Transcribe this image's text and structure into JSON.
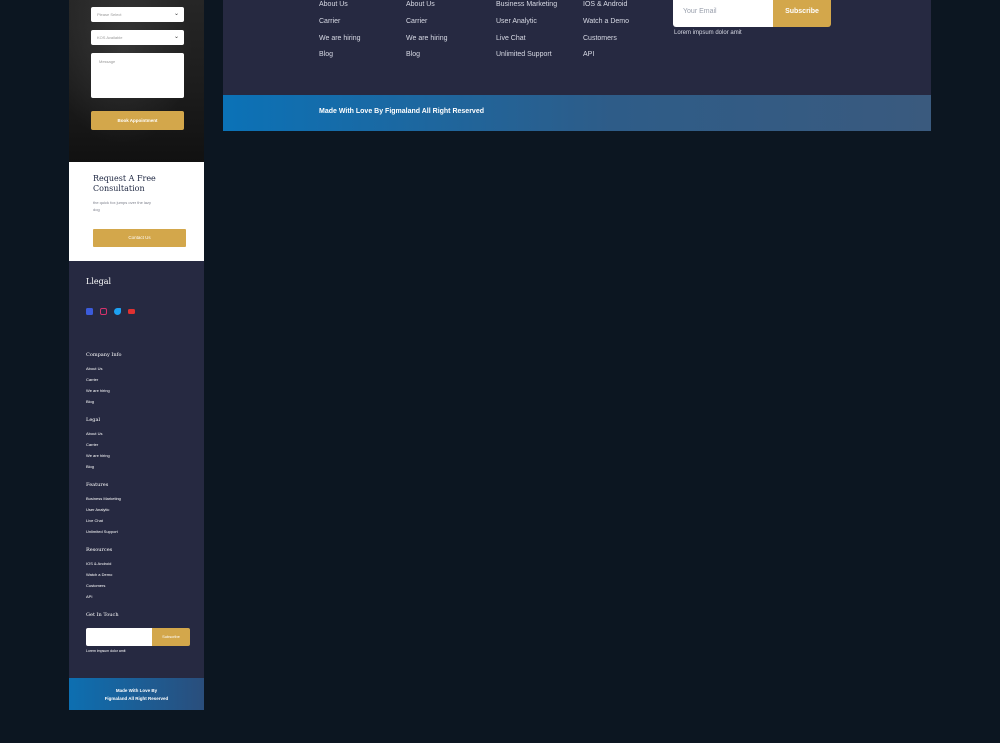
{
  "mobile": {
    "form": {
      "select1_placeholder": "Please Select",
      "select2_placeholder": "KOS Available",
      "message_placeholder": "Message",
      "submit_label": "Book Appointment"
    },
    "consult": {
      "title": "Request A Free Consultation",
      "text": "the quick fox jumps over the lazy dog",
      "button_label": "Contact Us"
    },
    "footer": {
      "logo": "Llegal",
      "social": [
        {
          "icon": "facebook-icon",
          "color": "#3b5bdb"
        },
        {
          "icon": "instagram-icon",
          "color": "#d6336c"
        },
        {
          "icon": "twitter-icon",
          "color": "#1da1f2"
        },
        {
          "icon": "youtube-icon",
          "color": "#e03131"
        }
      ],
      "sections": [
        {
          "heading": "Company Info",
          "items": [
            "About Us",
            "Carrier",
            "We are hiring",
            "Blog"
          ]
        },
        {
          "heading": "Legal",
          "items": [
            "About Us",
            "Carrier",
            "We are hiring",
            "Blog"
          ]
        },
        {
          "heading": "Features",
          "items": [
            "Business Marketing",
            "User Analytic",
            "Live Chat",
            "Unlimited Support"
          ]
        },
        {
          "heading": "Resources",
          "items": [
            "IOS & Android",
            "Watch a Demo",
            "Customers",
            "API"
          ]
        }
      ],
      "get_in_touch": "Get In Touch",
      "subscribe_label": "Subscribe",
      "lorem": "Lorem impsum dolor amit",
      "bottom_line1": "Made With Love By",
      "bottom_line2": "Figmaland All Right Reserved"
    }
  },
  "desktop": {
    "columns": [
      {
        "items": [
          "About Us",
          "Carrier",
          "We are hiring",
          "Blog"
        ]
      },
      {
        "items": [
          "About Us",
          "Carrier",
          "We are hiring",
          "Blog"
        ]
      },
      {
        "items": [
          "Business Marketing",
          "User Analytic",
          "Live Chat",
          "Unlimited Support"
        ]
      },
      {
        "items": [
          "IOS & Android",
          "Watch a Demo",
          "Customers",
          "API"
        ]
      }
    ],
    "email_placeholder": "Your Email",
    "subscribe_label": "Subscribe",
    "lorem": "Lorem impsum dolor amit",
    "bottom_text": "Made With Love By Figmaland All Right Reserved"
  },
  "colors": {
    "navy": "#262941",
    "gold": "#d3a74b",
    "page_bg": "#0c1621",
    "bar_blue": "#0b72b7"
  }
}
